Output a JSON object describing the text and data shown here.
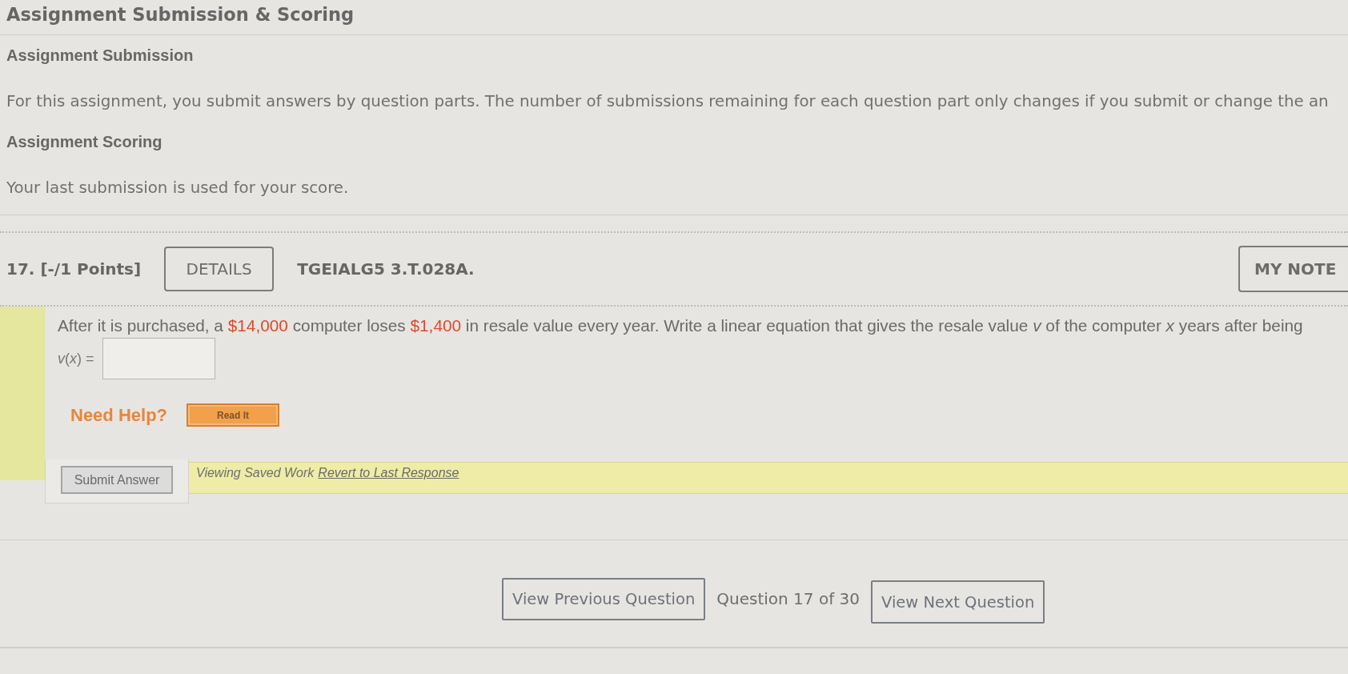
{
  "page_title": "Assignment Submission & Scoring",
  "sections": [
    {
      "heading": "Assignment Submission",
      "text": "For this assignment, you submit answers by question parts. The number of submissions remaining for each question part only changes if you submit or change the an"
    },
    {
      "heading": "Assignment Scoring",
      "text": "Your last submission is used for your score."
    }
  ],
  "question": {
    "label": "17. [-/1 Points]",
    "details_button": "DETAILS",
    "code": "TGEIALG5 3.T.028A.",
    "notes_button": "MY NOTE",
    "prompt": "After it is purchased, a **$14,000** computer loses **$1,400** in resale value every year. Write a linear equation that gives the resale value *v* of the computer *x* years after being",
    "answer_label": "*v*(*x*) =",
    "help": {
      "label": "Need Help?",
      "button": "Read It"
    },
    "submit_button": "Submit Answer",
    "saved_work": {
      "text": "Viewing Saved Work",
      "link": "Revert to Last Response"
    }
  },
  "navigation": {
    "previous_button": "View Previous Question",
    "counter": "Question 17 of 30",
    "next_button": "View Next Question"
  }
}
